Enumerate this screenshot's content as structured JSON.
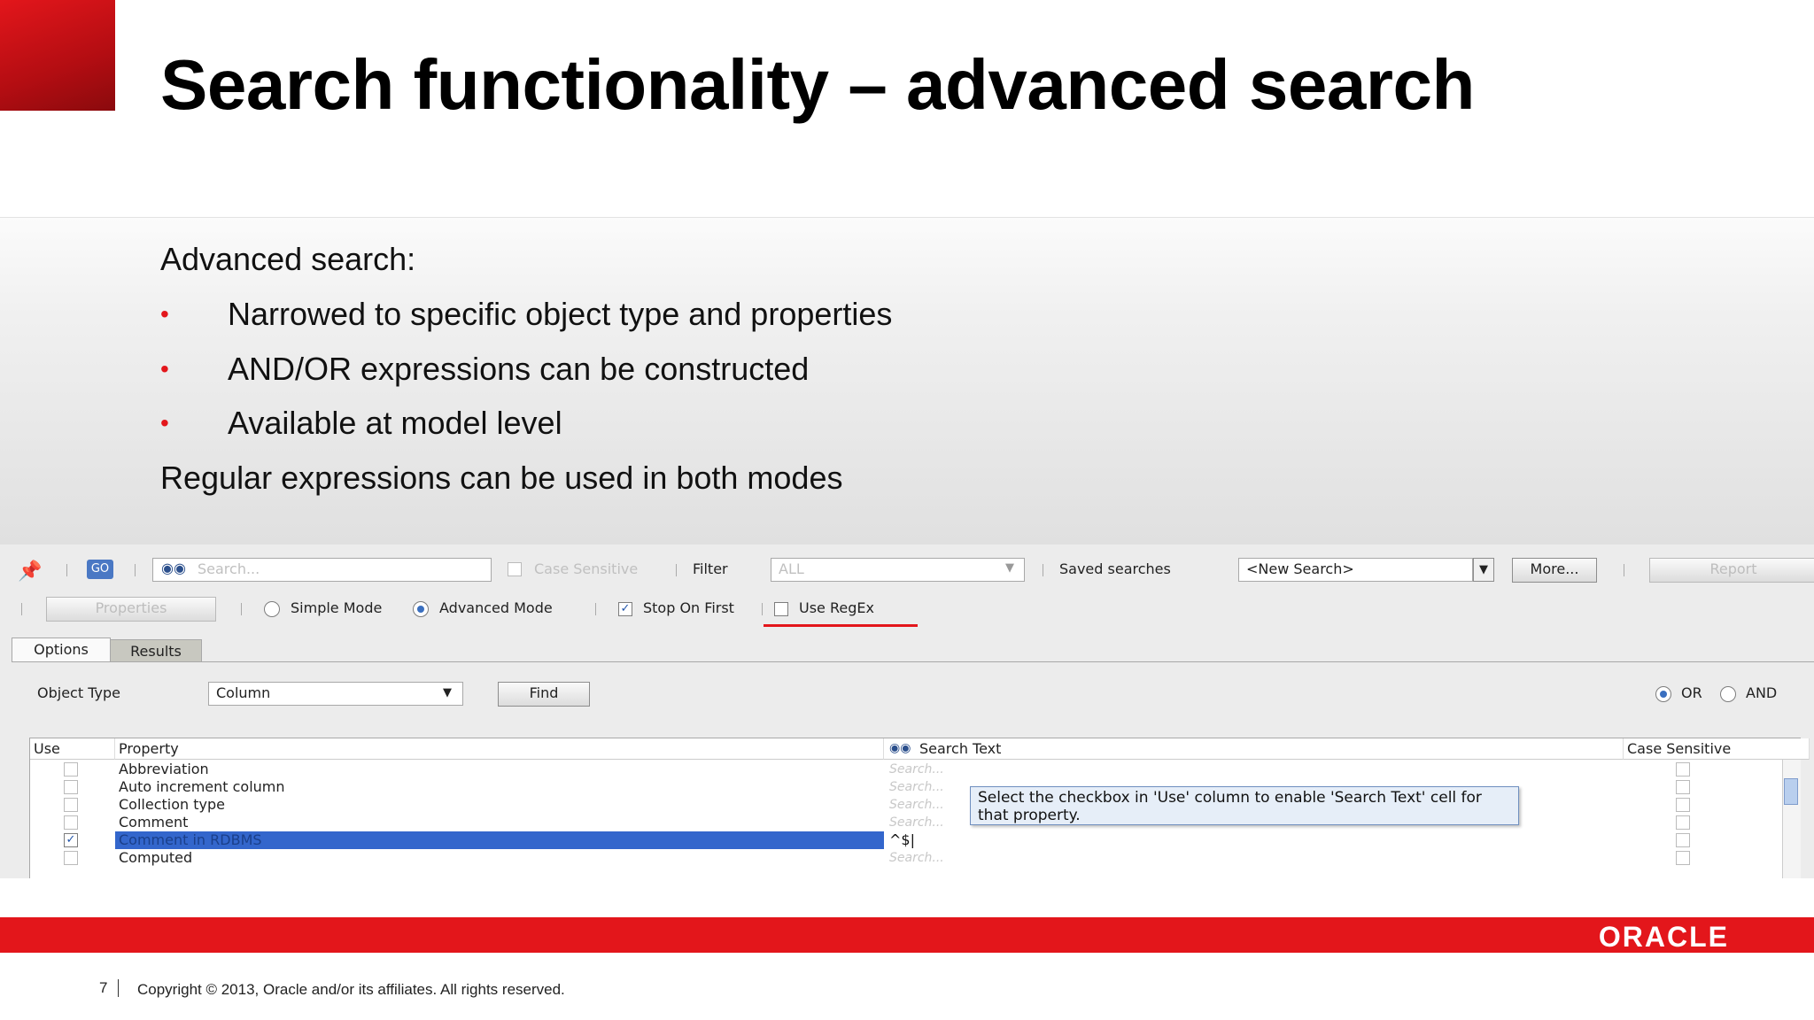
{
  "slide": {
    "title": "Search functionality – advanced search",
    "intro": "Advanced search:",
    "bullets": [
      "Narrowed to specific object type and properties",
      "AND/OR expressions can be constructed",
      "Available at model level"
    ],
    "closing": "Regular expressions can be used in both modes",
    "page_number": "7",
    "copyright": "Copyright © 2013, Oracle and/or its affiliates. All rights reserved.",
    "logo": "ORACLE",
    "accent_color": "#e3161b"
  },
  "search_ui": {
    "toolbar": {
      "search_placeholder": "Search...",
      "case_sensitive": "Case Sensitive",
      "filter_label": "Filter",
      "filter_value": "ALL",
      "saved_searches_label": "Saved searches",
      "saved_search_value": "<New Search>",
      "more_button": "More...",
      "report_button": "Report"
    },
    "mode_bar": {
      "properties_button": "Properties",
      "simple_mode": "Simple Mode",
      "advanced_mode": "Advanced Mode",
      "stop_on_first": "Stop On First",
      "use_regex": "Use RegEx"
    },
    "tabs": [
      "Options",
      "Results"
    ],
    "object_type_label": "Object Type",
    "object_type_value": "Column",
    "find_button": "Find",
    "or_label": "OR",
    "and_label": "AND",
    "grid": {
      "headers": [
        "Use",
        "Property",
        "Search Text",
        "Case Sensitive"
      ],
      "rows": [
        {
          "property": "Abbreviation",
          "search_text": "Search...",
          "checked": false
        },
        {
          "property": "Auto increment column",
          "search_text": "Search...",
          "checked": false
        },
        {
          "property": "Collection type",
          "search_text": "Search...",
          "checked": false
        },
        {
          "property": "Comment",
          "search_text": "Search...",
          "checked": false
        },
        {
          "property": "Comment in RDBMS",
          "search_text": "^$|",
          "checked": true
        },
        {
          "property": "Computed",
          "search_text": "Search...",
          "checked": false
        }
      ]
    },
    "tooltip": "Select the checkbox in 'Use' column to enable 'Search Text' cell for that property."
  }
}
